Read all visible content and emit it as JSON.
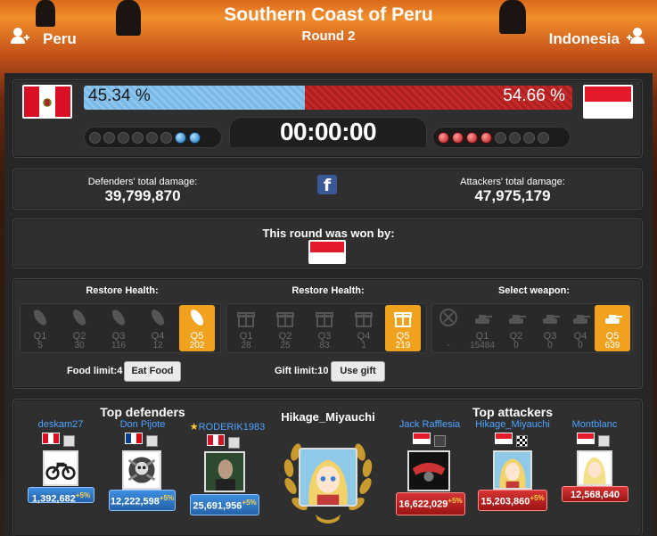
{
  "battle": {
    "title": "Southern Coast of Peru",
    "round": "Round 2",
    "defender": "Peru",
    "attacker": "Indonesia",
    "defender_percent_text": "45.34 %",
    "attacker_percent_text": "54.66 %",
    "defender_share": 0.4534,
    "timer": "00:00:00",
    "defender_rounds_won": 2,
    "attacker_rounds_won": 4,
    "defender_damage_label": "Defenders' total damage:",
    "defender_damage": "39,799,870",
    "attacker_damage_label": "Attackers' total damage:",
    "attacker_damage": "47,975,179",
    "facebook_glyph": "f",
    "won_by_text": "This round was won by:",
    "winner": "Indonesia"
  },
  "consumables": {
    "food_title": "Restore Health:",
    "gift_title": "Restore Health:",
    "weapon_title": "Select weapon:",
    "food": [
      {
        "q": "Q1",
        "v": "5"
      },
      {
        "q": "Q2",
        "v": "30"
      },
      {
        "q": "Q3",
        "v": "116"
      },
      {
        "q": "Q4",
        "v": "12"
      },
      {
        "q": "Q5",
        "v": "202"
      }
    ],
    "gift": [
      {
        "q": "Q1",
        "v": "28"
      },
      {
        "q": "Q2",
        "v": "25"
      },
      {
        "q": "Q3",
        "v": "83"
      },
      {
        "q": "Q4",
        "v": "1"
      },
      {
        "q": "Q5",
        "v": "219"
      }
    ],
    "weapon": [
      {
        "q": "",
        "v": "-"
      },
      {
        "q": "Q1",
        "v": "15484"
      },
      {
        "q": "Q2",
        "v": "0"
      },
      {
        "q": "Q3",
        "v": "0"
      },
      {
        "q": "Q4",
        "v": "0"
      },
      {
        "q": "Q5",
        "v": "639"
      }
    ],
    "food_limit": "Food limit:4",
    "eat_food": "Eat Food",
    "gift_limit": "Gift limit:10",
    "use_gift": "Use gift"
  },
  "top": {
    "defenders_title": "Top defenders",
    "attackers_title": "Top attackers",
    "hero": "Hikage_Miyauchi",
    "defenders": [
      {
        "name": "deskam27",
        "damage": "1,392,682",
        "bonus": "+5%"
      },
      {
        "name": "Don Pijote",
        "damage": "12,222,598",
        "bonus": "+5%"
      },
      {
        "name": "RODERIK1983",
        "damage": "25,691,956",
        "bonus": "+5%"
      }
    ],
    "attackers": [
      {
        "name": "Jack Rafflesia",
        "damage": "16,622,029",
        "bonus": "+5%"
      },
      {
        "name": "Hikage_Miyauchi",
        "damage": "15,203,860",
        "bonus": "+5%"
      },
      {
        "name": "Montblanc",
        "damage": "12,568,640",
        "bonus": ""
      }
    ],
    "star_glyph": "★"
  },
  "colors": {
    "defender_bar": "#7ab8e6",
    "attacker_bar": "#b01f1f",
    "active_slot": "#f0a21f",
    "link": "#4da3ff"
  }
}
